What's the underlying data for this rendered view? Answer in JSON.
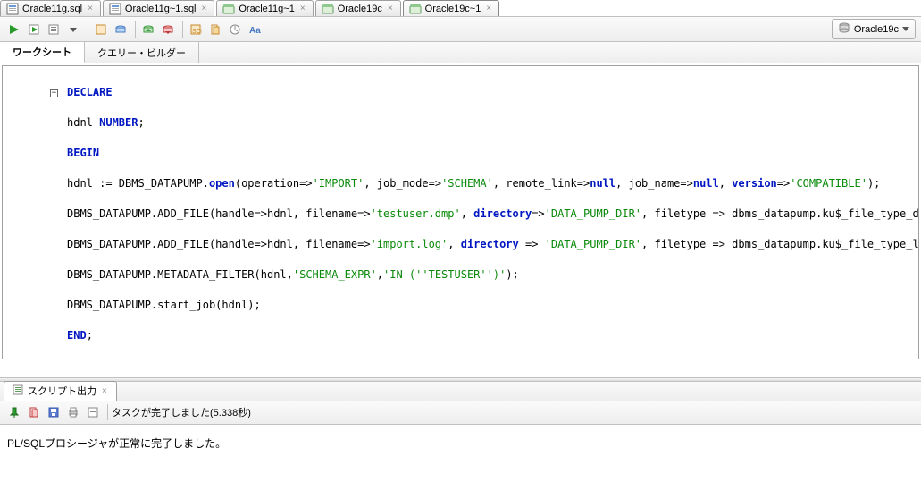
{
  "tabs": [
    {
      "label": "Oracle11g.sql",
      "icon": "sql"
    },
    {
      "label": "Oracle11g~1.sql",
      "icon": "sql"
    },
    {
      "label": "Oracle11g~1",
      "icon": "db"
    },
    {
      "label": "Oracle19c",
      "icon": "db"
    },
    {
      "label": "Oracle19c~1",
      "icon": "db",
      "active": true
    }
  ],
  "connection": {
    "label": "Oracle19c"
  },
  "subtabs": {
    "worksheet": "ワークシート",
    "querybuilder": "クエリー・ビルダー"
  },
  "code": {
    "l1": "DECLARE",
    "l2a": "hdnl ",
    "l2b": "NUMBER",
    "l2c": ";",
    "l3": "BEGIN",
    "l4a": "hdnl := DBMS_DATAPUMP.",
    "l4b": "open",
    "l4c": "(operation=>",
    "l4d": "'IMPORT'",
    "l4e": ", job_mode=>",
    "l4f": "'SCHEMA'",
    "l4g": ", remote_link=>",
    "l4h": "null",
    "l4i": ", job_name=>",
    "l4j": "null",
    "l4k": ", ",
    "l4l": "version",
    "l4m": "=>",
    "l4n": "'COMPATIBLE'",
    "l4o": ");",
    "l5a": "DBMS_DATAPUMP.ADD_FILE(handle=>hdnl, filename=>",
    "l5b": "'testuser.dmp'",
    "l5c": ", ",
    "l5d": "directory",
    "l5e": "=>",
    "l5f": "'DATA_PUMP_DIR'",
    "l5g": ", filetype => dbms_datapump.ku$_file_type_dump_file);",
    "l6a": "DBMS_DATAPUMP.ADD_FILE(handle=>hdnl, filename=>",
    "l6b": "'import.log'",
    "l6c": ", ",
    "l6d": "directory",
    "l6e": " => ",
    "l6f": "'DATA_PUMP_DIR'",
    "l6g": ", filetype => dbms_datapump.ku$_file_type_log_file);",
    "l7a": "DBMS_DATAPUMP.METADATA_FILTER(hdnl,",
    "l7b": "'SCHEMA_EXPR'",
    "l7c": ",",
    "l7d": "'IN (''TESTUSER'')'",
    "l7e": ");",
    "l8": "DBMS_DATAPUMP.start_job(hdnl);",
    "l9": "END",
    "l9b": ";",
    "l10": "/"
  },
  "output": {
    "tab_label": "スクリプト出力",
    "status_prefix": "タスクが完了しました(",
    "status_time": "5.338秒",
    "status_suffix": ")",
    "body": "PL/SQLプロシージャが正常に完了しました。"
  }
}
